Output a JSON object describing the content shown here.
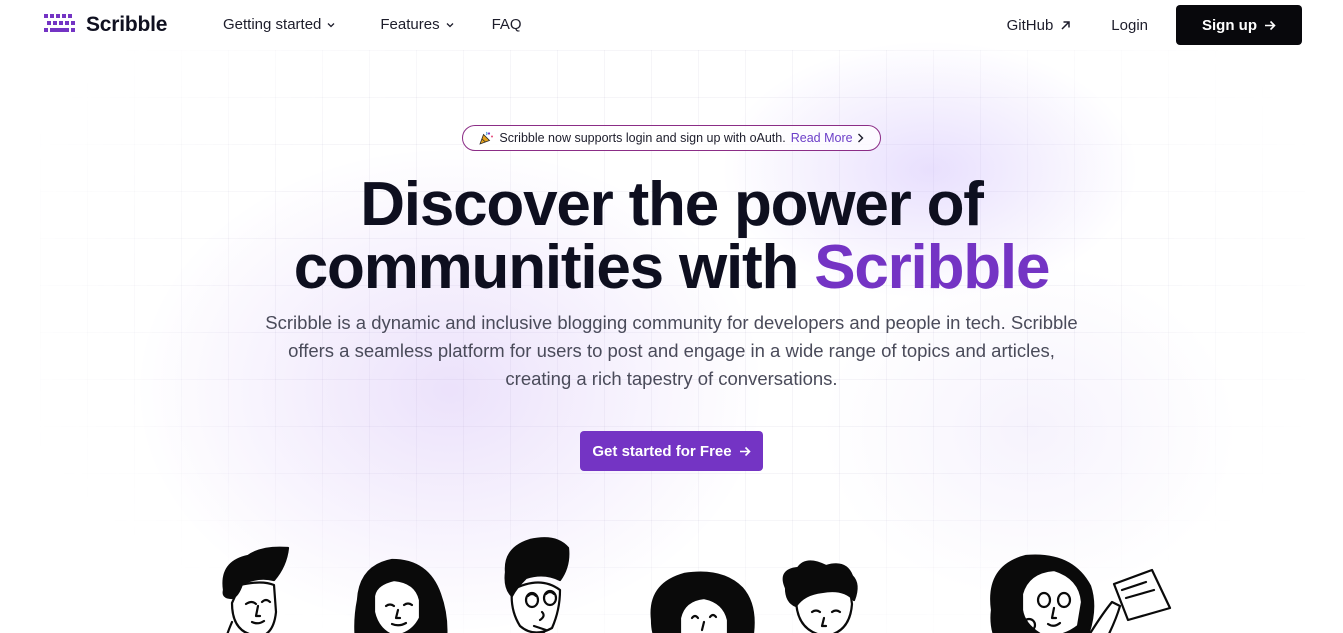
{
  "nav": {
    "brand": "Scribble",
    "links": [
      {
        "label": "Getting started",
        "has_dropdown": true
      },
      {
        "label": "Features",
        "has_dropdown": true
      },
      {
        "label": "FAQ",
        "has_dropdown": false
      }
    ],
    "github_label": "GitHub",
    "login_label": "Login",
    "signup_label": "Sign up"
  },
  "announcement": {
    "text": "Scribble now supports login and sign up with oAuth.",
    "link_label": "Read More"
  },
  "hero": {
    "title_line1": "Discover the power of",
    "title_line2_prefix": "communities with ",
    "title_line2_accent": "Scribble",
    "description": "Scribble is a dynamic and inclusive blogging community for developers and people in tech. Scribble offers a seamless platform for users to post and engage in a wide range of topics and articles, creating a rich tapestry of conversations.",
    "cta_label": "Get started for Free"
  },
  "icons": {
    "brand": "keyboard-icon",
    "dropdown": "chevron-down-icon",
    "external": "arrow-up-right-icon",
    "arrow": "arrow-right-icon",
    "announcement": "party-popper-icon"
  },
  "colors": {
    "accent": "#7434c4",
    "dark_button": "#08080c",
    "pill_border": "#8b2d86",
    "text": "#0e0f1f"
  }
}
